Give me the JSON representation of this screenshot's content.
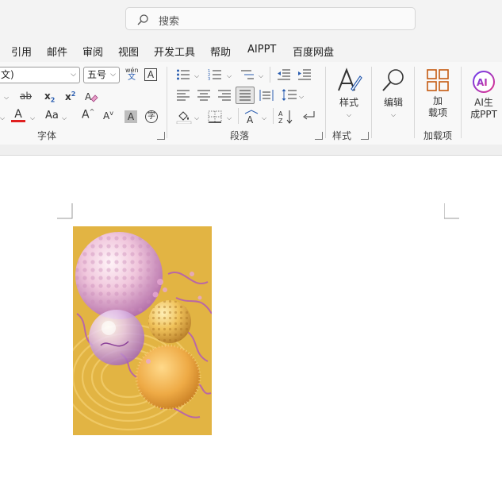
{
  "search": {
    "placeholder": "搜索"
  },
  "menu": [
    "引用",
    "邮件",
    "审阅",
    "视图",
    "开发工具",
    "帮助",
    "AIPPT",
    "百度网盘"
  ],
  "font_group": {
    "font_name": "文)",
    "font_size": "五号",
    "phonetic_top": "wén",
    "phonetic_bottom": "文",
    "strike": "ab",
    "subscript_base": "x",
    "subscript": "2",
    "superscript_base": "x",
    "superscript": "2",
    "font_color_letter": "A",
    "change_case": "Aa",
    "grow": "A",
    "shrink": "A",
    "char_shade": "A",
    "enclose": "字",
    "border_char": "A",
    "label": "字体",
    "font_color_hex": "#e02020"
  },
  "paragraph_group": {
    "label": "段落"
  },
  "styles_group": {
    "button": "样式",
    "label": "样式"
  },
  "edit": {
    "button": "编辑"
  },
  "addins": {
    "button_line1": "加",
    "button_line2": "载项",
    "label": "加载项"
  },
  "ai": {
    "line1": "AI生",
    "line2": "成PPT"
  }
}
